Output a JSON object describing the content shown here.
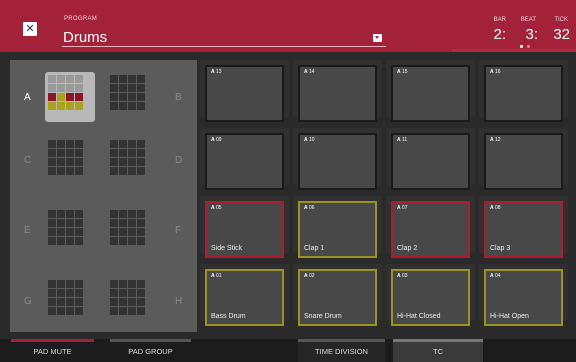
{
  "header": {
    "program_label": "PROGRAM",
    "program_value": "Drums",
    "bar_label": "BAR",
    "beat_label": "BEAT",
    "tick_label": "TICK",
    "bar_value": "2:",
    "beat_value": "3:",
    "tick_value": "32",
    "close_icon": "close-icon"
  },
  "banks": {
    "letters": [
      "A",
      "B",
      "C",
      "D",
      "E",
      "F",
      "G",
      "H"
    ],
    "active": "A"
  },
  "pads": [
    {
      "bank": "A",
      "num": "13",
      "name": ""
    },
    {
      "bank": "A",
      "num": "14",
      "name": ""
    },
    {
      "bank": "A",
      "num": "15",
      "name": ""
    },
    {
      "bank": "A",
      "num": "16",
      "name": ""
    },
    {
      "bank": "A",
      "num": "09",
      "name": ""
    },
    {
      "bank": "A",
      "num": "10",
      "name": ""
    },
    {
      "bank": "A",
      "num": "11",
      "name": ""
    },
    {
      "bank": "A",
      "num": "12",
      "name": ""
    },
    {
      "bank": "A",
      "num": "05",
      "name": "Side Stick"
    },
    {
      "bank": "A",
      "num": "06",
      "name": "Clap 1"
    },
    {
      "bank": "A",
      "num": "07",
      "name": "Clap 2"
    },
    {
      "bank": "A",
      "num": "08",
      "name": "Clap 3"
    },
    {
      "bank": "A",
      "num": "01",
      "name": "Bass Drum"
    },
    {
      "bank": "A",
      "num": "02",
      "name": "Snare Drum"
    },
    {
      "bank": "A",
      "num": "03",
      "name": "Hi-Hat Closed"
    },
    {
      "bank": "A",
      "num": "04",
      "name": "Hi-Hat Open"
    }
  ],
  "tabs": {
    "pad_mute": "PAD MUTE",
    "pad_group": "PAD GROUP",
    "time_division": "TIME DIVISION",
    "tc": "TC"
  },
  "colors": {
    "header": "#a4213a",
    "pad_red": "#b01b32",
    "pad_yellow": "#9a9420",
    "mini_red": "#8c1428",
    "mini_yellow": "#a8a21e",
    "mini_gray": "#9a9a9a"
  }
}
